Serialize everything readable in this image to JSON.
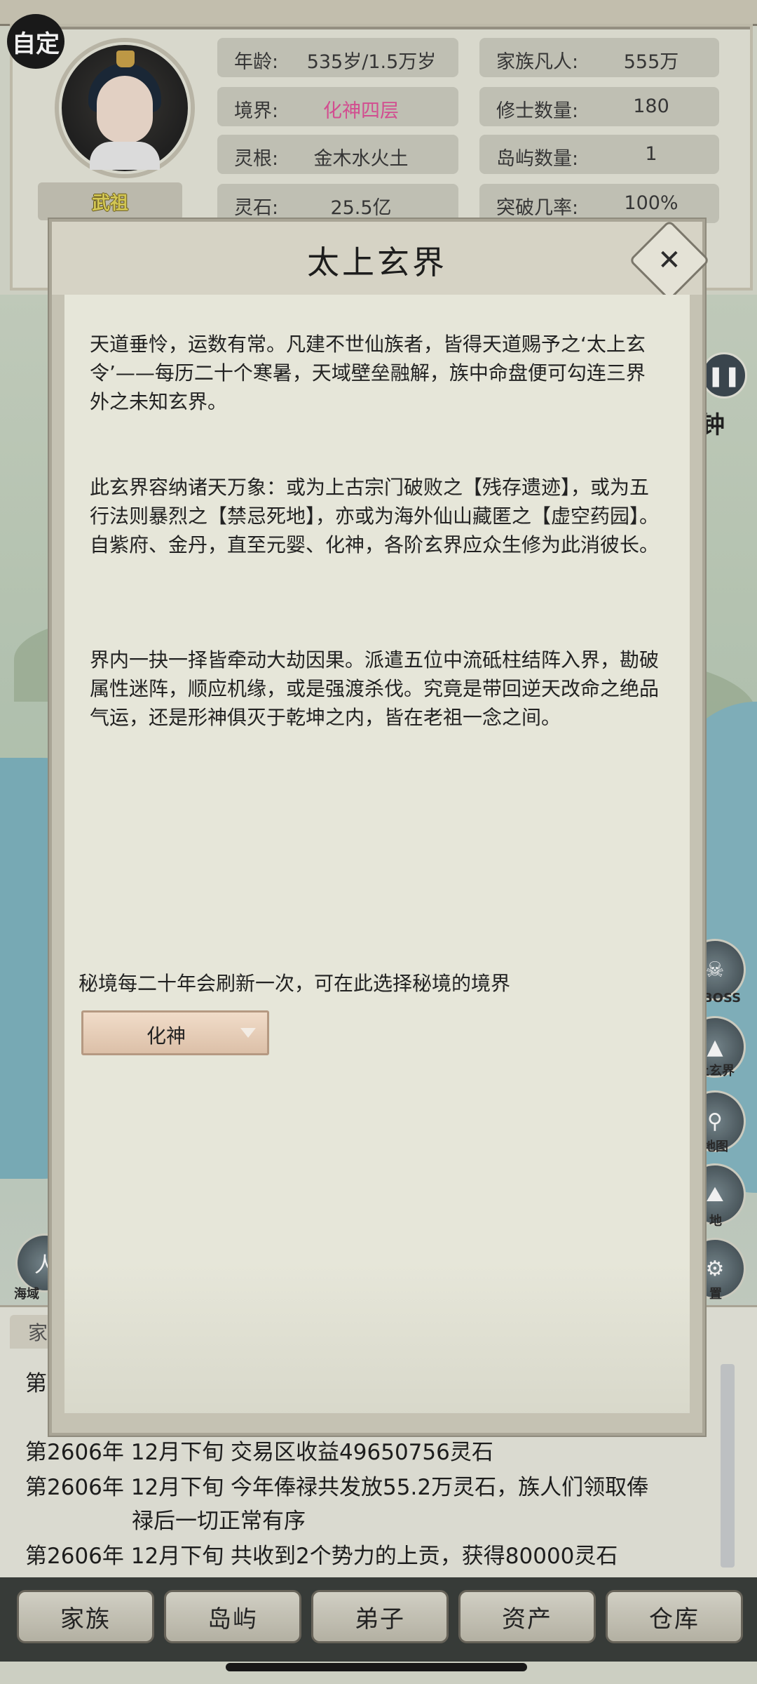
{
  "header": {
    "custom_badge": "自定",
    "title_badge": "武祖",
    "stats": [
      {
        "label": "年龄:",
        "value": "535岁/1.5万岁"
      },
      {
        "label": "家族凡人:",
        "value": "555万"
      },
      {
        "label": "境界:",
        "value": "化神四层"
      },
      {
        "label": "修士数量:",
        "value": "180"
      },
      {
        "label": "灵根:",
        "value": "金木水火土"
      },
      {
        "label": "岛屿数量:",
        "value": "1"
      },
      {
        "label": "灵石:",
        "value": "25.5亿"
      },
      {
        "label": "突破几率:",
        "value": "100%"
      }
    ],
    "realm_color": "#e0529a"
  },
  "map": {
    "clock_text": "钟",
    "side_buttons": [
      {
        "icon": "boss-icon",
        "label": "界BOSS"
      },
      {
        "icon": "mountain-icon",
        "label": "上玄界"
      },
      {
        "icon": "map-pin-icon",
        "label": "地图"
      },
      {
        "icon": "land-icon",
        "label": "地"
      },
      {
        "icon": "gear-icon",
        "label": "置"
      }
    ],
    "left_button_label": "海域"
  },
  "modal": {
    "title": "太上玄界",
    "paragraphs": [
      "天道垂怜，运数有常。凡建不世仙族者，皆得天道赐予之‘太上玄令’——每历二十个寒暑，天域壁垒融解，族中命盘便可勾连三界外之未知玄界。",
      "此玄界容纳诸天万象：或为上古宗门破败之【残存遗迹】，或为五行法则暴烈之【禁忌死地】，亦或为海外仙山藏匿之【虚空药园】。自紫府、金丹，直至元婴、化神，各阶玄界应众生修为此消彼长。",
      "界内一抉一择皆牵动大劫因果。派遣五位中流砥柱结阵入界，勘破属性迷阵，顺应机缘，或是强渡杀伐。究竟是带回逆天改命之绝品气运，还是形神俱灭于乾坤之内，皆在老祖一念之间。"
    ],
    "hint": "秘境每二十年会刷新一次，可在此选择秘境的境界",
    "realm_select": {
      "value": "化神"
    }
  },
  "log": {
    "tab_label": "家",
    "lines": [
      {
        "text": "第2606年 12月下旬 交易区收益49650756灵石"
      },
      {
        "text": "第2606年 12月下旬 今年俸禄共发放55.2万灵石，族人们领取俸"
      },
      {
        "text": "禄后一切正常有序"
      },
      {
        "text": "第2606年 12月下旬 共收到2个势力的上贡，获得80000灵石"
      }
    ],
    "partial_first": "第"
  },
  "nav": {
    "items": [
      {
        "label": "家族"
      },
      {
        "label": "岛屿"
      },
      {
        "label": "弟子"
      },
      {
        "label": "资产"
      },
      {
        "label": "仓库"
      }
    ]
  }
}
